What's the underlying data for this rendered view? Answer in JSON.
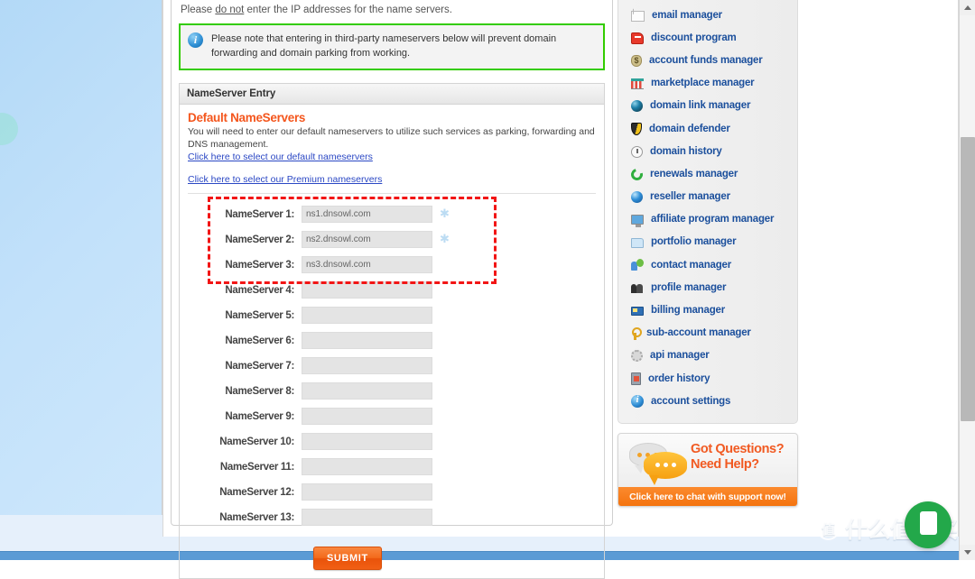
{
  "page": {
    "intro_prefix": "Please ",
    "intro_underline": "do not",
    "intro_suffix": " enter the IP addresses for the name servers."
  },
  "notice": {
    "icon": "info-icon",
    "text": "Please note that entering in third-party nameservers below will prevent domain forwarding and domain parking from working."
  },
  "section": {
    "header": "NameServer Entry",
    "default_title": "Default NameServers",
    "default_desc": "You will need to enter our default nameservers to utilize such services as parking, forwarding and DNS management.",
    "default_link": "Click here to select our default nameservers",
    "premium_link": "Click here to select our Premium nameservers"
  },
  "nameservers": [
    {
      "label": "NameServer 1:",
      "value": "ns1.dnsowl.com",
      "required": true
    },
    {
      "label": "NameServer 2:",
      "value": "ns2.dnsowl.com",
      "required": true
    },
    {
      "label": "NameServer 3:",
      "value": "ns3.dnsowl.com",
      "required": false
    },
    {
      "label": "NameServer 4:",
      "value": "",
      "required": false
    },
    {
      "label": "NameServer 5:",
      "value": "",
      "required": false
    },
    {
      "label": "NameServer 6:",
      "value": "",
      "required": false
    },
    {
      "label": "NameServer 7:",
      "value": "",
      "required": false
    },
    {
      "label": "NameServer 8:",
      "value": "",
      "required": false
    },
    {
      "label": "NameServer 9:",
      "value": "",
      "required": false
    },
    {
      "label": "NameServer 10:",
      "value": "",
      "required": false
    },
    {
      "label": "NameServer 11:",
      "value": "",
      "required": false
    },
    {
      "label": "NameServer 12:",
      "value": "",
      "required": false
    },
    {
      "label": "NameServer 13:",
      "value": "",
      "required": false
    }
  ],
  "submit_label": "SUBMIT",
  "sidebar": {
    "items": [
      {
        "label": "email manager",
        "icon": "mail-icon"
      },
      {
        "label": "discount program",
        "icon": "tag-icon"
      },
      {
        "label": "account funds manager",
        "icon": "money-bag-icon"
      },
      {
        "label": "marketplace manager",
        "icon": "shop-icon"
      },
      {
        "label": "domain link manager",
        "icon": "globe-icon"
      },
      {
        "label": "domain defender",
        "icon": "shield-icon"
      },
      {
        "label": "domain history",
        "icon": "clock-icon"
      },
      {
        "label": "renewals manager",
        "icon": "refresh-icon"
      },
      {
        "label": "reseller manager",
        "icon": "globe-blue-icon"
      },
      {
        "label": "affiliate program manager",
        "icon": "monitor-icon"
      },
      {
        "label": "portfolio manager",
        "icon": "folder-icon"
      },
      {
        "label": "contact manager",
        "icon": "contact-card-icon"
      },
      {
        "label": "profile manager",
        "icon": "people-icon"
      },
      {
        "label": "billing manager",
        "icon": "credit-card-icon"
      },
      {
        "label": "sub-account manager",
        "icon": "key-icon"
      },
      {
        "label": "api manager",
        "icon": "gear-icon"
      },
      {
        "label": "order history",
        "icon": "order-doc-icon"
      },
      {
        "label": "account settings",
        "icon": "info-circle-icon"
      }
    ]
  },
  "chat": {
    "title_line1": "Got Questions?",
    "title_line2": "Need Help?",
    "cta": "Click here to chat with support now!"
  },
  "watermark": {
    "mark": "值",
    "text": "什么值得买"
  },
  "colors": {
    "accent_orange": "#f4561d",
    "notice_border_green": "#33cc00",
    "annotation_red": "#f21515",
    "link_blue": "#2a47c4",
    "sidebar_link": "#1b4f9c",
    "fab_green": "#23a84a"
  }
}
